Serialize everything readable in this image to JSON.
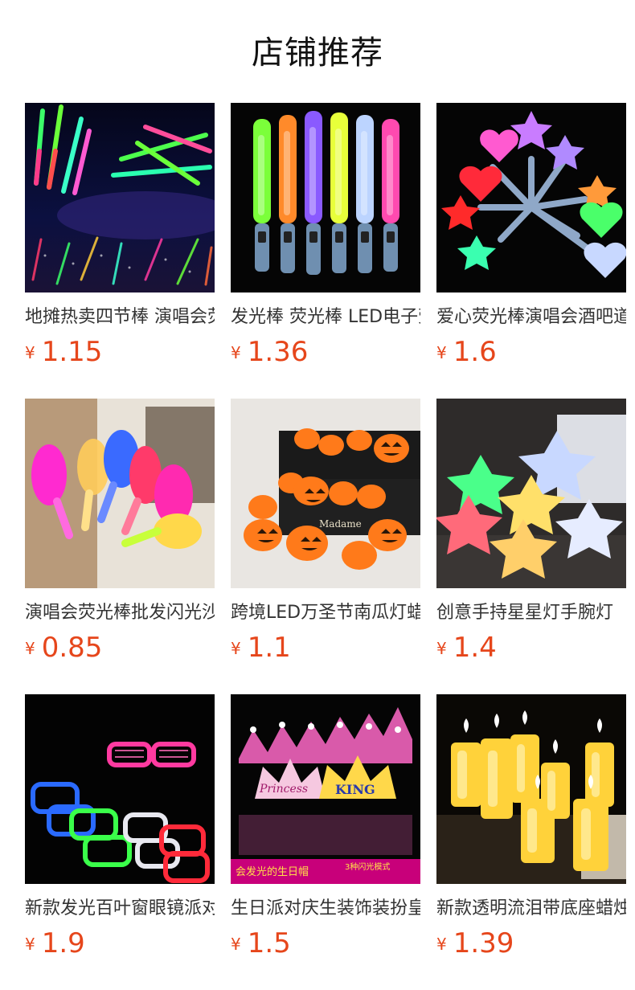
{
  "header": {
    "title": "店铺推荐"
  },
  "products": [
    {
      "name": "地摊热卖四节棒 演唱会荧光棒",
      "currency": "¥",
      "price": "1.15",
      "image": "foam-stick-concert-image"
    },
    {
      "name": "发光棒 荧光棒 LED电子荧光棒",
      "currency": "¥",
      "price": "1.36",
      "image": "led-light-sticks-image"
    },
    {
      "name": "爱心荧光棒演唱会酒吧道具",
      "currency": "¥",
      "price": "1.6",
      "image": "heart-star-wands-image"
    },
    {
      "name": "演唱会荧光棒批发闪光沙锤",
      "currency": "¥",
      "price": "0.85",
      "image": "glowing-maracas-image"
    },
    {
      "name": "跨境LED万圣节南瓜灯蜡烛灯",
      "currency": "¥",
      "price": "1.1",
      "image": "pumpkin-lanterns-image"
    },
    {
      "name": "创意手持星星灯手腕灯",
      "currency": "¥",
      "price": "1.4",
      "image": "star-lamps-image"
    },
    {
      "name": "新款发光百叶窗眼镜派对",
      "currency": "¥",
      "price": "1.9",
      "image": "shutter-glasses-image"
    },
    {
      "name": "生日派对庆生装饰装扮皇冠帽",
      "currency": "¥",
      "price": "1.5",
      "image": "birthday-crowns-image"
    },
    {
      "name": "新款透明流泪带底座蜡烛灯",
      "currency": "¥",
      "price": "1.39",
      "image": "candle-lights-image"
    }
  ],
  "image_text": {
    "birthday_banner": "会发光的生日帽",
    "birthday_banner_right": "3种闪光模式",
    "crown_princess": "Princess",
    "crown_king": "KING",
    "pumpkin_book": "Madame"
  }
}
